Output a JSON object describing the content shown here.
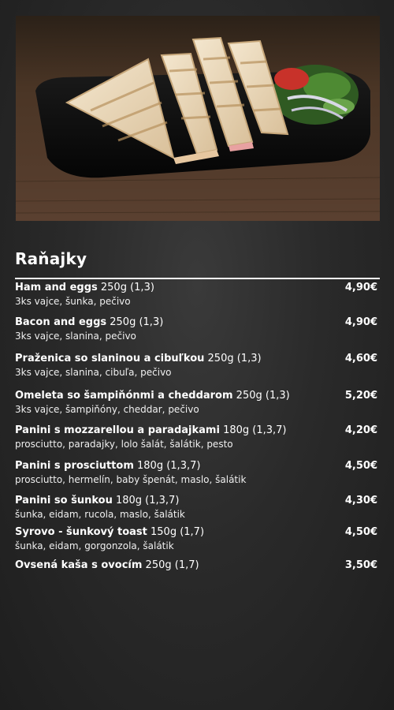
{
  "section": {
    "title": "Raňajky"
  },
  "colors": {
    "background": "#2a2a2a",
    "text": "#ffffff",
    "rule": "#ffffff"
  },
  "photo": {
    "subject": "grilled toast sandwiches with salad on black plate"
  },
  "items": [
    {
      "name": "Ham and eggs",
      "meta": "250g (1,3)",
      "desc": "3ks vajce, šunka, pečivo",
      "price": "4,90€"
    },
    {
      "name": "Bacon and eggs",
      "meta": "250g (1,3)",
      "desc": "3ks vajce, slanina, pečivo",
      "price": "4,90€"
    },
    {
      "name": "Praženica so slaninou a cibuľkou",
      "meta": "250g (1,3)",
      "desc": "3ks vajce, slanina, cibuľa, pečivo",
      "price": "4,60€"
    },
    {
      "name": "Omeleta so šampiňónmi a cheddarom",
      "meta": "250g (1,3)",
      "desc": "3ks vajce, šampiňóny, cheddar, pečivo",
      "price": "5,20€"
    },
    {
      "name": "Panini s mozzarellou a paradajkami",
      "meta": "180g (1,3,7)",
      "desc": "prosciutto, paradajky, lolo šalát, šalátik, pesto",
      "price": "4,20€"
    },
    {
      "name": "Panini s prosciuttom",
      "meta": "180g (1,3,7)",
      "desc": "prosciutto, hermelín, baby špenát, maslo, šalátik",
      "price": "4,50€"
    },
    {
      "name": "Panini so šunkou",
      "meta": "180g (1,3,7)",
      "desc": "šunka, eidam, rucola, maslo, šalátik",
      "price": "4,30€"
    },
    {
      "name": "Syrovo - šunkový toast",
      "meta": "150g (1,7)",
      "desc": "šunka, eidam, gorgonzola, šalátik",
      "price": "4,50€"
    },
    {
      "name": "Ovsená kaša s ovocím",
      "meta": "250g (1,7)",
      "desc": "",
      "price": "3,50€"
    }
  ]
}
